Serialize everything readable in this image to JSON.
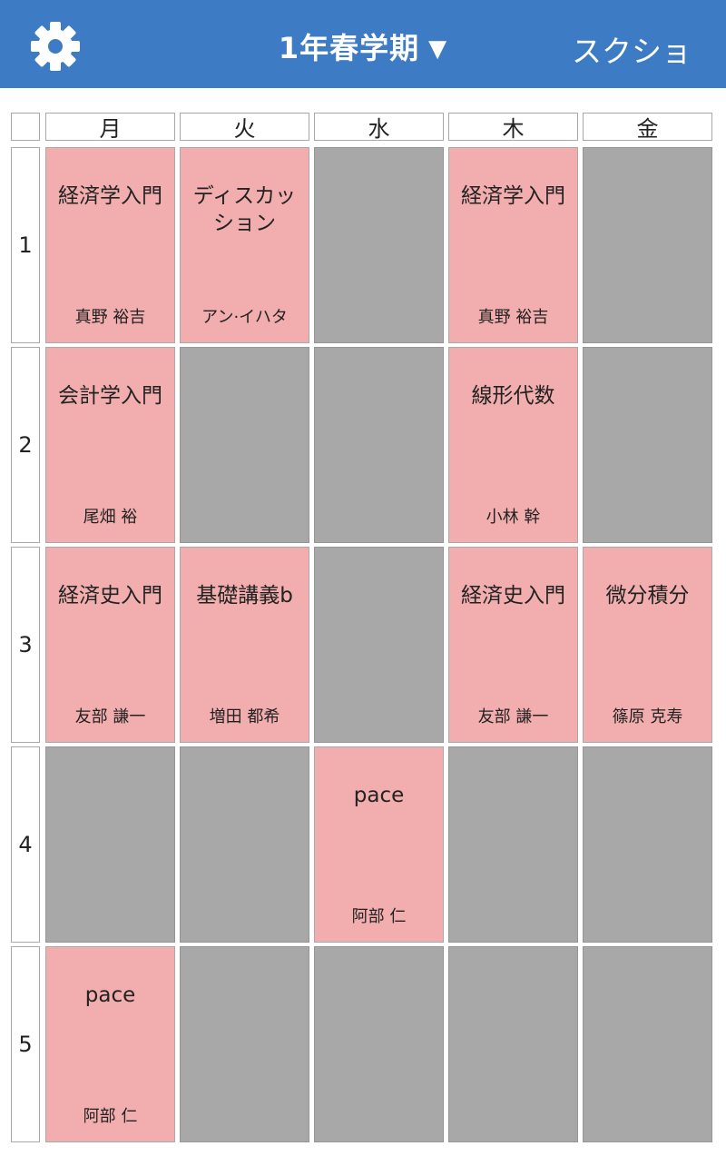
{
  "header": {
    "settings_icon": "gear-icon",
    "term_title": "1年春学期",
    "term_caret": "▼",
    "screenshot_label": "スクショ",
    "bg_color": "#3d7cc4"
  },
  "days": [
    "月",
    "火",
    "水",
    "木",
    "金"
  ],
  "periods": [
    "1",
    "2",
    "3",
    "4",
    "5"
  ],
  "colors": {
    "class_cell": "#f2aeae",
    "empty_cell": "#a8a8a8"
  },
  "timetable": [
    [
      {
        "course": "経済学入門",
        "teacher": "真野 裕吉"
      },
      {
        "course": "ディスカッション",
        "teacher": "アン·イハタ"
      },
      null,
      {
        "course": "経済学入門",
        "teacher": "真野 裕吉"
      },
      null
    ],
    [
      {
        "course": "会計学入門",
        "teacher": "尾畑 裕"
      },
      null,
      null,
      {
        "course": "線形代数",
        "teacher": "小林 幹"
      },
      null
    ],
    [
      {
        "course": "経済史入門",
        "teacher": "友部 謙一"
      },
      {
        "course": "基礎講義b",
        "teacher": "増田 都希"
      },
      null,
      {
        "course": "経済史入門",
        "teacher": "友部 謙一"
      },
      {
        "course": "微分積分",
        "teacher": "篠原 克寿"
      }
    ],
    [
      null,
      null,
      {
        "course": "pace",
        "teacher": "阿部 仁"
      },
      null,
      null
    ],
    [
      {
        "course": "pace",
        "teacher": "阿部 仁"
      },
      null,
      null,
      null,
      null
    ]
  ]
}
